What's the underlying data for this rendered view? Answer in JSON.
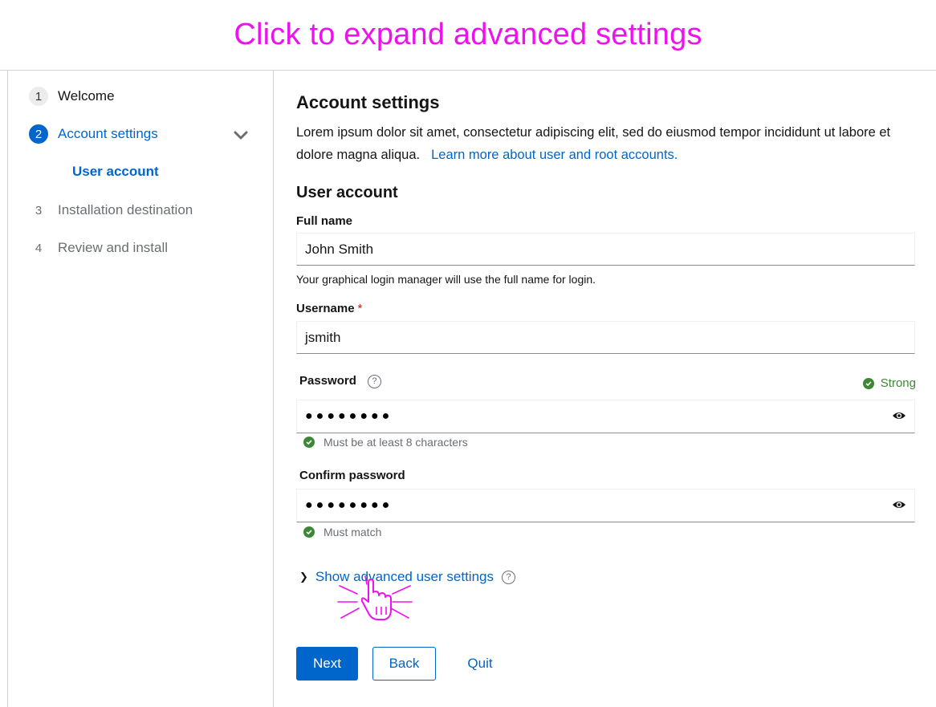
{
  "banner": {
    "text": "Click to expand advanced settings",
    "color": "#ee10ee"
  },
  "nav": {
    "steps": [
      {
        "number": "1",
        "label": "Welcome"
      },
      {
        "number": "2",
        "label": "Account settings"
      },
      {
        "number": "3",
        "label": "Installation destination"
      },
      {
        "number": "4",
        "label": "Review and install"
      }
    ],
    "substep": "User account"
  },
  "main": {
    "heading": "Account settings",
    "description": "Lorem ipsum dolor sit amet, consectetur adipiscing elit, sed do eiusmod tempor incididunt ut labore et dolore magna aliqua.",
    "learn_more": "Learn more about user and root accounts.",
    "section_heading": "User account",
    "full_name": {
      "label": "Full name",
      "value": "John Smith",
      "helper": "Your graphical login manager will use the full name for login."
    },
    "username": {
      "label": "Username",
      "required_mark": "*",
      "value": "jsmith"
    },
    "password": {
      "label": "Password",
      "help_glyph": "?",
      "strength": "Strong",
      "value": "●●●●●●●●",
      "rule": "Must be at least 8 characters"
    },
    "confirm_password": {
      "label": "Confirm password",
      "value": "●●●●●●●●",
      "rule": "Must match"
    },
    "advanced_toggle": {
      "caret": "❯",
      "label": "Show advanced user settings",
      "help_glyph": "?"
    }
  },
  "actions": {
    "next": "Next",
    "back": "Back",
    "quit": "Quit"
  },
  "colors": {
    "primary": "#0066cc",
    "success": "#3e8635",
    "required": "#c9190b"
  }
}
